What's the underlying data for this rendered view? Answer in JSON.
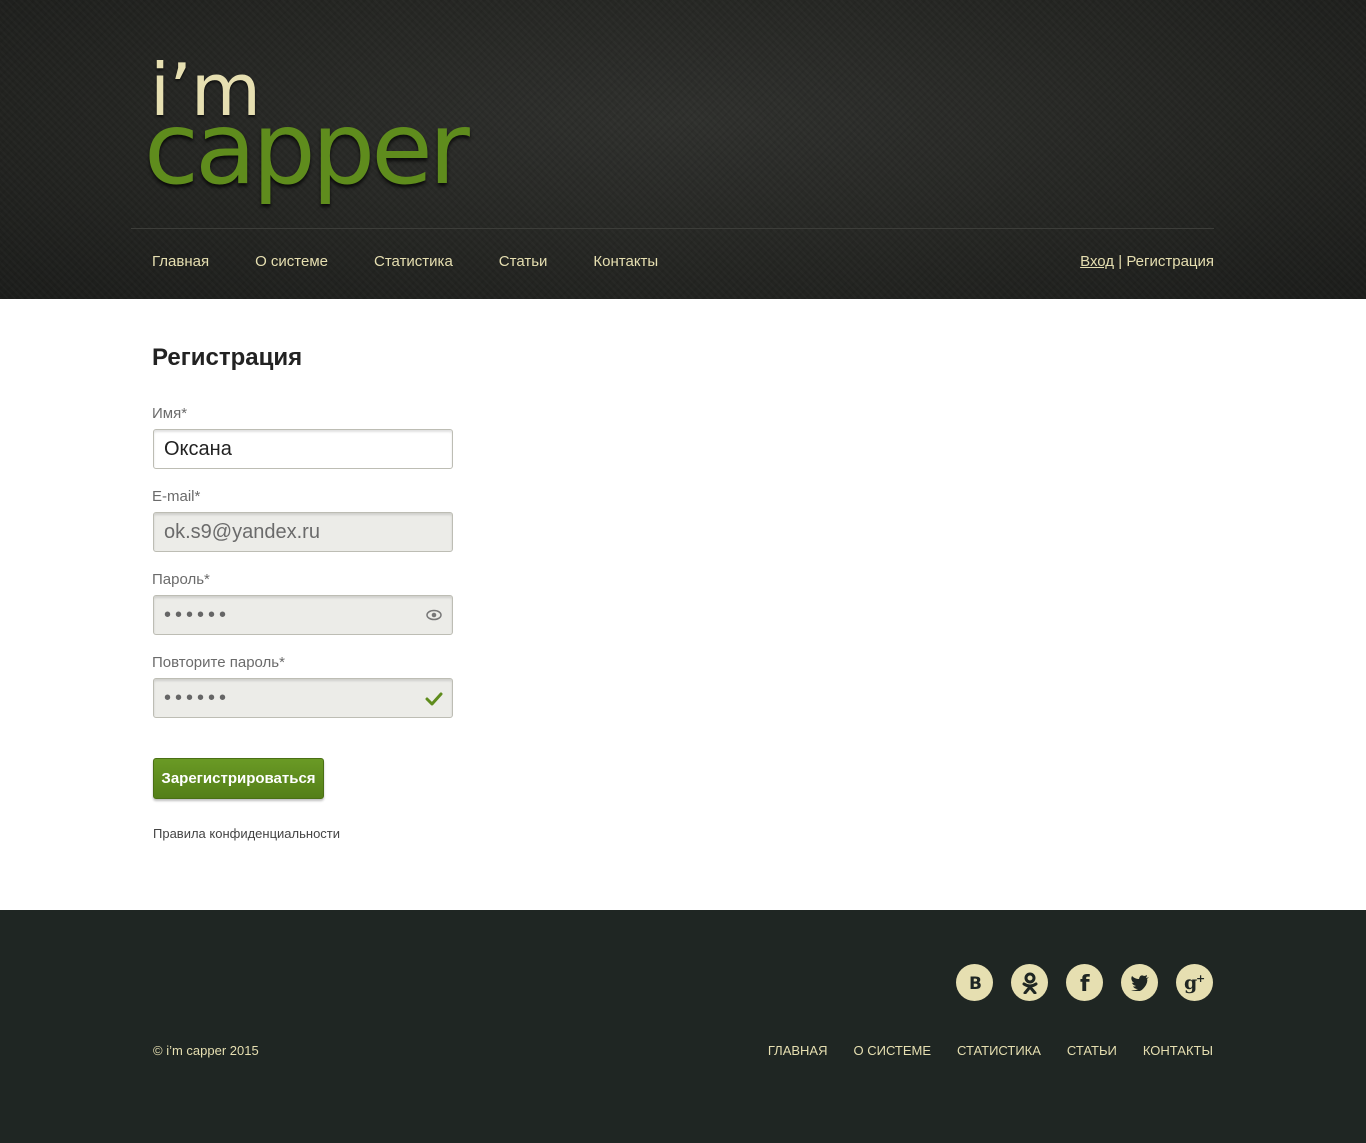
{
  "brand": {
    "line1": "i’m",
    "line2": "capper"
  },
  "nav": {
    "items": [
      "Главная",
      "О системе",
      "Статистика",
      "Статьи",
      "Контакты"
    ]
  },
  "auth": {
    "login": "Вход",
    "separator": "|",
    "register": "Регистрация"
  },
  "form": {
    "title": "Регистрация",
    "name_label": "Имя*",
    "name_value": "Оксана",
    "email_label": "E-mail*",
    "email_value": "ok.s9@yandex.ru",
    "password_label": "Пароль*",
    "password_value": "••••••",
    "repeat_label": "Повторите пароль*",
    "repeat_value": "••••••",
    "submit_label": "Зарегистрироваться",
    "privacy_link": "Правила конфиденциальности"
  },
  "footer": {
    "socials": [
      {
        "name": "vk-icon",
        "glyph": "B"
      },
      {
        "name": "odnoklassniki-icon",
        "glyph": "ok"
      },
      {
        "name": "facebook-icon",
        "glyph": "f"
      },
      {
        "name": "twitter-icon",
        "glyph": "t"
      },
      {
        "name": "google-plus-icon",
        "glyph": "g+"
      }
    ],
    "copyright": "© i’m capper 2015",
    "nav": [
      "ГЛАВНАЯ",
      "О СИСТЕМЕ",
      "СТАТИСТИКА",
      "СТАТЬИ",
      "КОНТАКТЫ"
    ]
  },
  "colors": {
    "accent": "#5f8c1d",
    "cream": "#e6dfb1",
    "footer_bg": "#1f2623"
  }
}
